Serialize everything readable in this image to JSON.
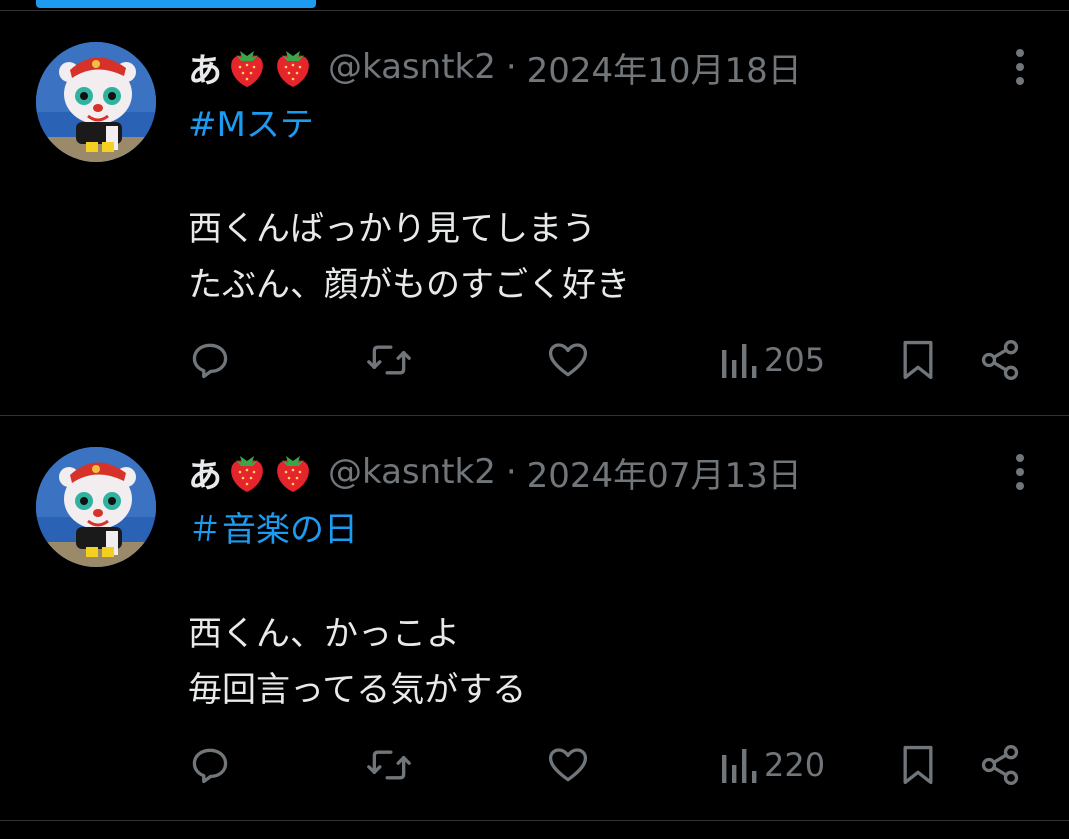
{
  "tweets": [
    {
      "display_name": "あ",
      "emoji": [
        "strawberry-icon",
        "strawberry-icon"
      ],
      "handle": "@kasntk2",
      "separator": "·",
      "date": "2024年10月18日",
      "hashtag": "#Mステ",
      "lines": [
        "西くんばっかり見てしまう",
        "たぶん、顔がものすごく好き"
      ],
      "views": "205"
    },
    {
      "display_name": "あ",
      "emoji": [
        "strawberry-icon",
        "strawberry-icon"
      ],
      "handle": "@kasntk2",
      "separator": "·",
      "date": "2024年07月13日",
      "hashtag": "＃音楽の日",
      "lines": [
        "西くん、かっこよ",
        "毎回言ってる気がする"
      ],
      "views": "220"
    }
  ],
  "colors": {
    "background": "#000000",
    "text": "#e7e9ea",
    "secondary": "#71767b",
    "accent": "#1d9bf0",
    "divider": "#2f3336"
  }
}
